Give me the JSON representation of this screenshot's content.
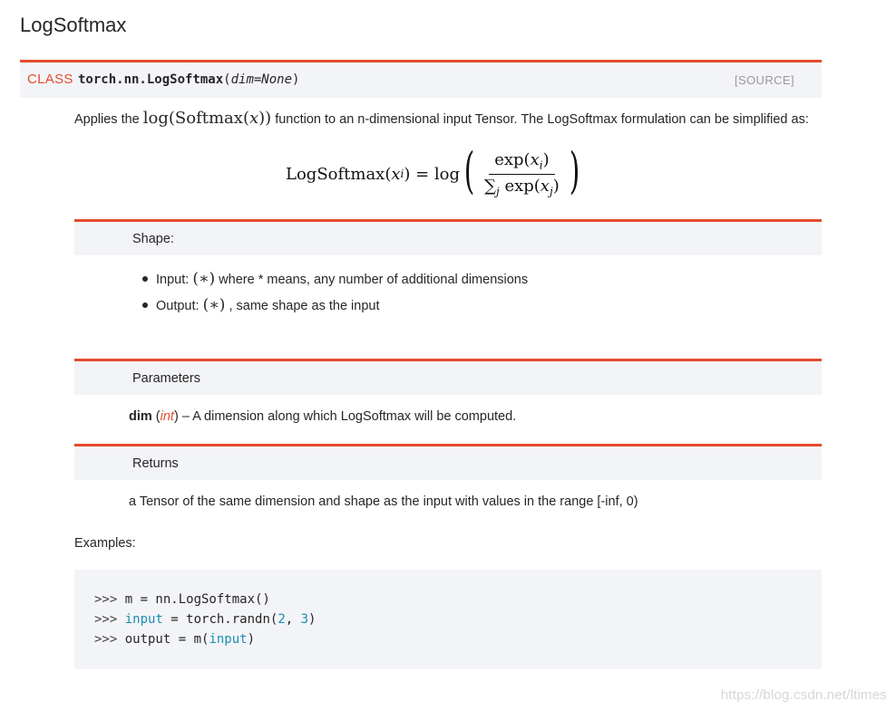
{
  "page": {
    "title": "LogSoftmax"
  },
  "class_header": {
    "label": "CLASS",
    "signature_name": "torch.nn.LogSoftmax",
    "open_paren": "(",
    "param": "dim=None",
    "close_paren": ")",
    "source": "[SOURCE]"
  },
  "description": {
    "before": "Applies the ",
    "math_log": "log",
    "math_open": "(Softmax(",
    "math_var": "x",
    "math_close": "))",
    "after": " function to an n-dimensional input Tensor. The LogSoftmax formulation can be simplified as:"
  },
  "formula": {
    "lhs_name": "LogSoftmax(",
    "lhs_var": "x",
    "lhs_sub": "i",
    "lhs_close": ")",
    "equals": " = log",
    "left_paren": "(",
    "num_text": "exp(",
    "num_var": "x",
    "num_sub": "i",
    "num_close": ")",
    "den_sum": "∑",
    "den_sum_sub": "j",
    "den_text": " exp(",
    "den_var": "x",
    "den_sub": "j",
    "den_close": ")",
    "right_paren": ")"
  },
  "shape": {
    "header": "Shape:",
    "items": [
      {
        "prefix": "Input: ",
        "math": "(∗)",
        "suffix": " where * means, any number of additional dimensions"
      },
      {
        "prefix": "Output: ",
        "math": "(∗)",
        "suffix": " , same shape as the input"
      }
    ]
  },
  "parameters": {
    "header": "Parameters",
    "name": "dim",
    "open": " (",
    "type": "int",
    "close": ")",
    "desc": " – A dimension along which LogSoftmax will be computed."
  },
  "returns": {
    "header": "Returns",
    "text": "a Tensor of the same dimension and shape as the input with values in the range [-inf, 0)"
  },
  "examples": {
    "label": "Examples:",
    "lines": [
      {
        "prompt": ">>> ",
        "a": "m = nn.LogSoftmax()",
        "kw": "",
        "b": "",
        "n1": "",
        "c": "",
        "n2": "",
        "d": ""
      },
      {
        "prompt": ">>> ",
        "a": "",
        "kw": "input",
        "b": " = torch.randn(",
        "n1": "2",
        "c": ", ",
        "n2": "3",
        "d": ")"
      },
      {
        "prompt": ">>> ",
        "a": "output = m(",
        "kw": "input",
        "b": ")",
        "n1": "",
        "c": "",
        "n2": "",
        "d": ""
      }
    ]
  },
  "watermark": {
    "text": "https://blog.csdn.net/ltimes"
  },
  "colors": {
    "accent": "#e44c2c",
    "header_bg": "#f3f4f7",
    "code_keyword": "#1a8fb0",
    "source_gray": "#999999"
  }
}
